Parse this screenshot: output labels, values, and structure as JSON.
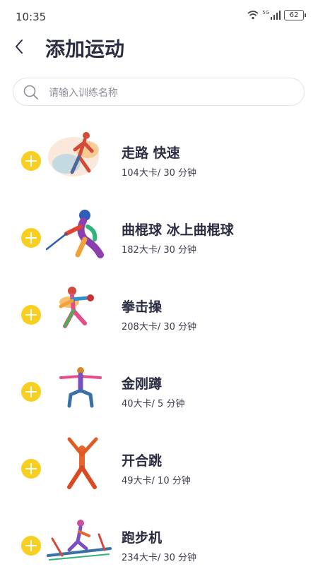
{
  "status": {
    "time": "10:35",
    "battery": "62",
    "network": "5G"
  },
  "header": {
    "title": "添加运动"
  },
  "search": {
    "placeholder": "请输入训练名称",
    "value": ""
  },
  "items": [
    {
      "name": "走路 快速",
      "calories": "104大卡/ 30 分钟",
      "icon": "walking-figure"
    },
    {
      "name": "曲棍球 冰上曲棍球",
      "calories": "182大卡/ 30 分钟",
      "icon": "hockey-figure"
    },
    {
      "name": "拳击操",
      "calories": "208大卡/ 30 分钟",
      "icon": "boxing-figure"
    },
    {
      "name": "金刚蹲",
      "calories": "40大卡/ 5 分钟",
      "icon": "squat-figure"
    },
    {
      "name": "开合跳",
      "calories": "49大卡/ 10 分钟",
      "icon": "jumping-jack-figure"
    },
    {
      "name": "跑步机",
      "calories": "234大卡/ 30 分钟",
      "icon": "treadmill-figure"
    }
  ],
  "colors": {
    "accent": "#f8cf21",
    "title": "#2b2d42"
  }
}
